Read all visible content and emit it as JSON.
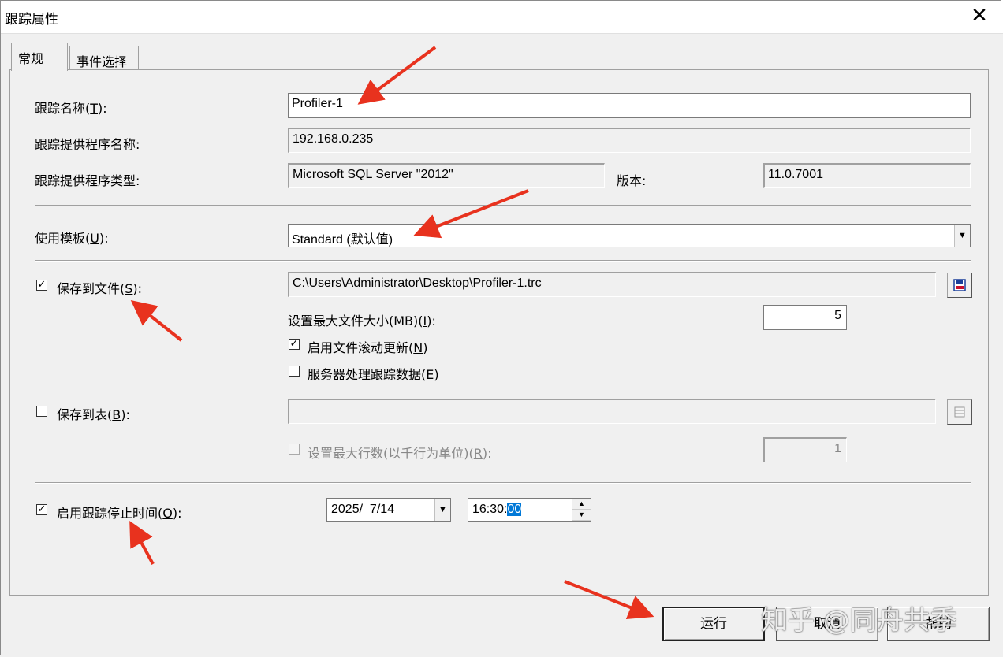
{
  "window": {
    "title": "跟踪属性",
    "close_glyph": "✕"
  },
  "tabs": [
    {
      "label": "常规",
      "active": true
    },
    {
      "label": "事件选择",
      "active": false
    }
  ],
  "general": {
    "trace_name": {
      "label_pre": "跟踪名称(",
      "accel": "T",
      "label_post": "):",
      "value": "Profiler-1"
    },
    "provider_name": {
      "label": "跟踪提供程序名称:",
      "value": "192.168.0.235"
    },
    "provider_type": {
      "label": "跟踪提供程序类型:",
      "value": "Microsoft SQL Server \"2012\""
    },
    "version": {
      "label": "版本:",
      "value": "11.0.7001"
    },
    "template": {
      "label_pre": "使用模板(",
      "accel": "U",
      "label_post": "):",
      "value": "Standard (默认值)"
    },
    "save_to_file": {
      "label_pre": "保存到文件(",
      "accel": "S",
      "label_post": "):",
      "checked": true,
      "path": "C:\\Users\\Administrator\\Desktop\\Profiler-1.trc",
      "max_size_label_pre": "设置最大文件大小(MB)(",
      "max_size_accel": "I",
      "max_size_label_post": "):",
      "max_size_value": "5",
      "rollover_label_pre": "启用文件滚动更新(",
      "rollover_accel": "N",
      "rollover_label_post": ")",
      "rollover_checked": true,
      "server_process_label_pre": "服务器处理跟踪数据(",
      "server_process_accel": "E",
      "server_process_label_post": ")",
      "server_process_checked": false
    },
    "save_to_table": {
      "label_pre": "保存到表(",
      "accel": "B",
      "label_post": "):",
      "checked": false,
      "value": "",
      "max_rows_label_pre": "设置最大行数(以千行为单位)(",
      "max_rows_accel": "R",
      "max_rows_label_post": "):",
      "max_rows_checked": false,
      "max_rows_value": "1"
    },
    "stop_time": {
      "label_pre": "启用跟踪停止时间(",
      "accel": "O",
      "label_post": "):",
      "checked": true,
      "date": "2025/  7/14",
      "time_prefix": "16:30:",
      "time_selected": "00"
    }
  },
  "buttons": {
    "run": "运行",
    "cancel": "取消",
    "help": "帮助"
  },
  "glyphs": {
    "check": "✓",
    "dropdown": "▼",
    "spin_up": "▲",
    "spin_down": "▼"
  },
  "watermark": "知乎 @同舟共季",
  "colors": {
    "arrow": "#e8321e",
    "selection": "#0078d7"
  }
}
